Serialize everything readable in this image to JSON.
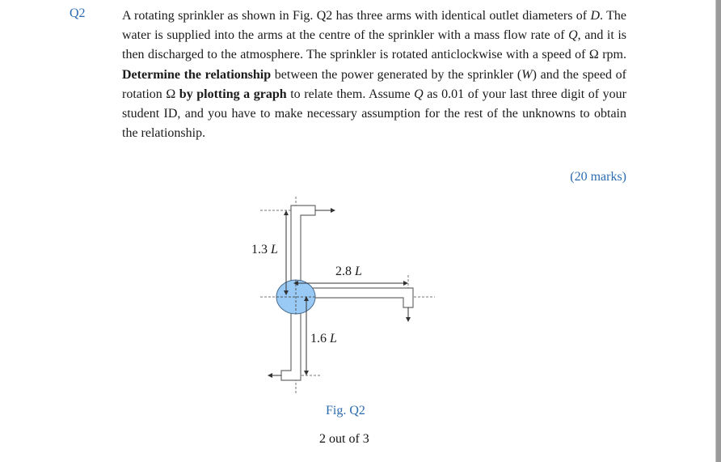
{
  "question": {
    "number": "Q2",
    "text_parts": {
      "p1": "A rotating sprinkler as shown in Fig. Q2 has three arms with identical outlet diameters of ",
      "var_D": "D",
      "p2": ". The water is supplied into the arms at the centre of the sprinkler with a mass flow rate of ",
      "var_Q1": "Q",
      "p3": ", and it is then discharged to the atmosphere. The sprinkler is rotated anticlockwise with a speed of Ω rpm. ",
      "bold1": "Determine the relationship",
      "p4": " between the power generated by the sprinkler (",
      "var_W": "W",
      "p5": ") and the speed of rotation Ω ",
      "bold2": "by plotting a graph",
      "p6": " to relate them. Assume ",
      "var_Q2": "Q",
      "p7": " as 0.01 of your last three digit of your student ID, and you have to make necessary assumption for the rest of the unknowns to obtain the relationship."
    },
    "marks": "(20 marks)"
  },
  "figure": {
    "dimensions": {
      "top_arm": {
        "value": "1.3 ",
        "unit": "L"
      },
      "right_arm": {
        "value": "2.8 ",
        "unit": "L"
      },
      "bottom_arm": {
        "value": "1.6 ",
        "unit": "L"
      }
    },
    "caption": "Fig. Q2",
    "colors": {
      "hub_fill": "#99c9f5",
      "hub_stroke": "#4a6a8a",
      "line": "#6b6b6b",
      "arrow": "#333333"
    }
  },
  "footer": {
    "page_indicator": "2 out of 3"
  },
  "colors": {
    "accent_blue": "#2b6cb0",
    "text": "#1a1a1a"
  }
}
